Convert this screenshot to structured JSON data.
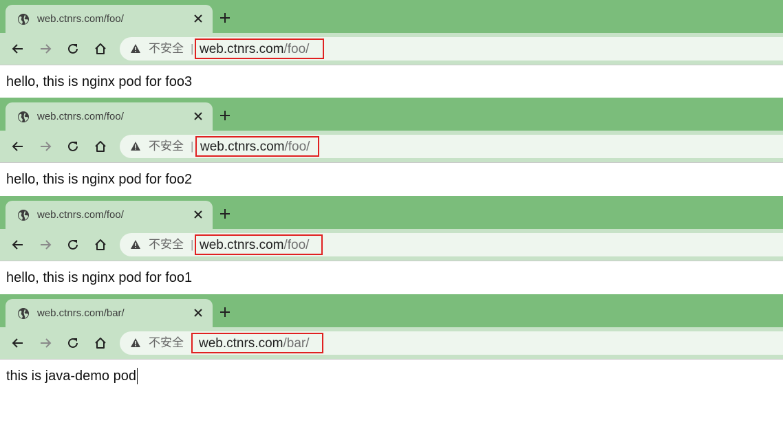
{
  "windows": [
    {
      "tab_title": "web.ctnrs.com/foo/",
      "security_label": "不安全",
      "separator": "|",
      "url_host": "web.ctnrs.com",
      "url_path": "/foo/",
      "content_text": "hello, this is nginx pod for foo3"
    },
    {
      "tab_title": "web.ctnrs.com/foo/",
      "security_label": "不安全",
      "separator": "|",
      "url_host": "web.ctnrs.com",
      "url_path": "/foo/",
      "content_text": "hello, this is nginx pod for foo2"
    },
    {
      "tab_title": "web.ctnrs.com/foo/",
      "security_label": "不安全",
      "separator": "|",
      "url_host": "web.ctnrs.com",
      "url_path": "/foo/",
      "content_text": "hello, this is nginx pod for foo1"
    },
    {
      "tab_title": "web.ctnrs.com/bar/",
      "security_label": "不安全",
      "separator": "|",
      "url_host": "web.ctnrs.com",
      "url_path": "/bar/",
      "content_text": "this is java-demo pod"
    }
  ],
  "colors": {
    "tabstrip": "#7bbd7b",
    "active_tab": "#c7e2c7",
    "omnibox": "#eef6ee",
    "highlight_box": "#e02020"
  },
  "icons": [
    "globe-icon",
    "close-icon",
    "plus-icon",
    "back-arrow-icon",
    "forward-arrow-icon",
    "reload-icon",
    "home-icon",
    "warning-triangle-icon"
  ]
}
